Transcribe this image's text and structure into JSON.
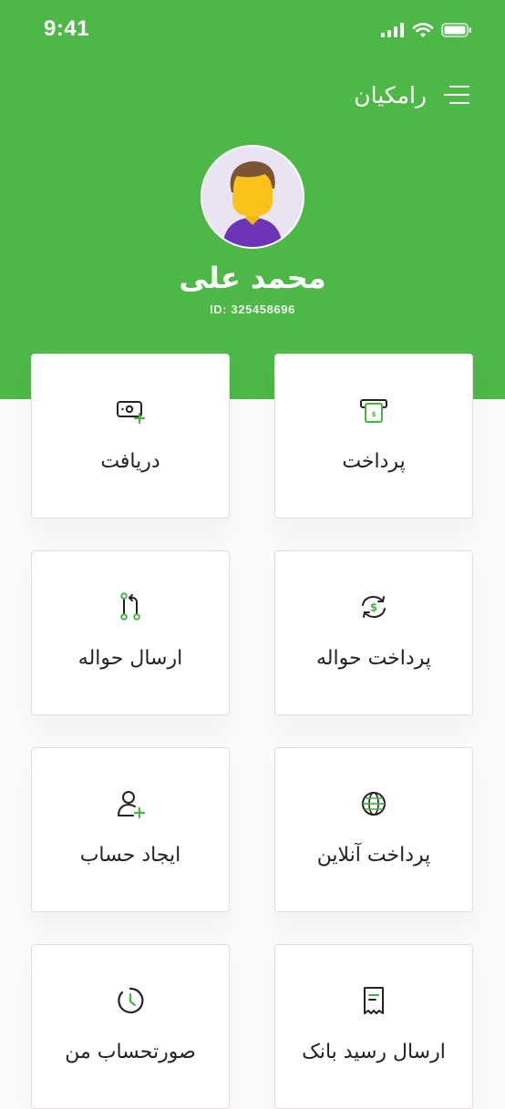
{
  "status_bar": {
    "time": "9:41",
    "icons": [
      "signal-icon",
      "wifi-icon",
      "battery-icon"
    ]
  },
  "header": {
    "brand": "رامکیان",
    "menu_icon": "hamburger-menu-icon"
  },
  "profile": {
    "name": "محمد علی",
    "id_text": "ID: 325458696",
    "avatar_icon": "user-avatar"
  },
  "actions": [
    {
      "label": "پرداخت",
      "icon": "pos-payment-icon"
    },
    {
      "label": "دریافت",
      "icon": "receive-money-icon"
    },
    {
      "label": "پرداخت حواله",
      "icon": "money-transfer-icon"
    },
    {
      "label": "ارسال حواله",
      "icon": "send-transfer-icon"
    },
    {
      "label": "پرداخت آنلاین",
      "icon": "globe-icon"
    },
    {
      "label": "ایجاد حساب",
      "icon": "add-user-icon"
    },
    {
      "label": "ارسال رسید بانک",
      "icon": "receipt-icon"
    },
    {
      "label": "صورتحساب من",
      "icon": "clock-icon"
    }
  ],
  "colors": {
    "brand_green": "#4db848",
    "card_bg": "#ffffff",
    "page_bg": "#fafafa",
    "text_dark": "#222222"
  }
}
